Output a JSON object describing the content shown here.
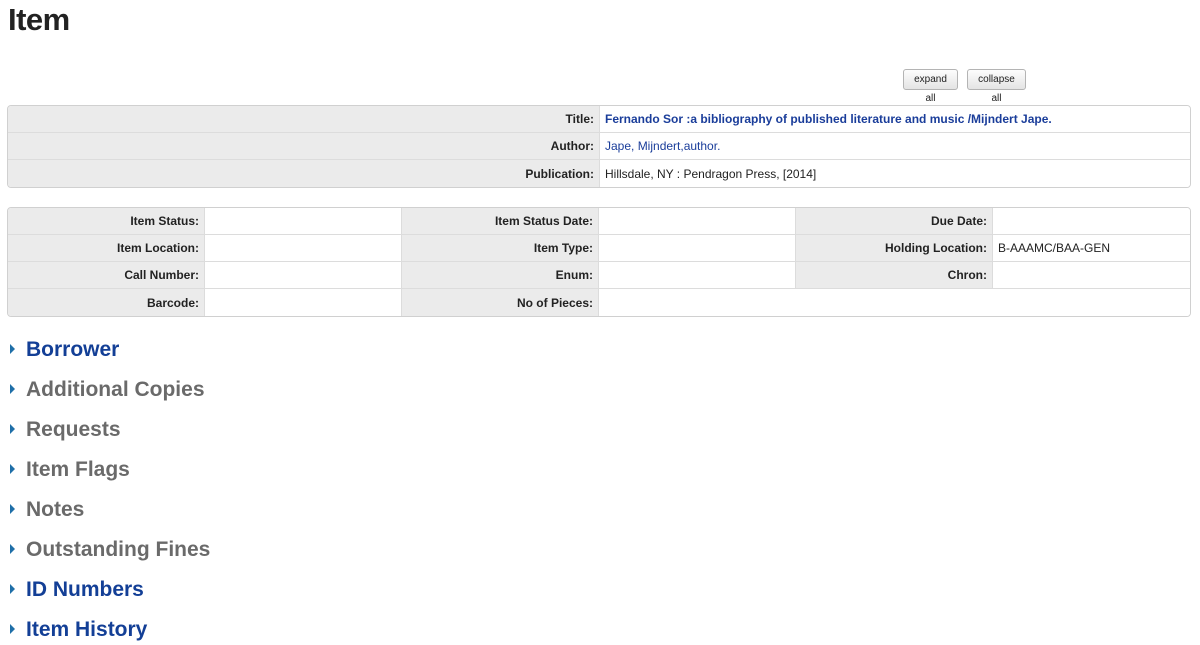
{
  "page": {
    "title": "Item"
  },
  "toolbar": {
    "expand_label": "expand all",
    "collapse_label": "collapse all"
  },
  "bib": {
    "title_label": "Title:",
    "title_value": "Fernando Sor :a bibliography of published literature and music /Mijndert Jape.",
    "author_label": "Author:",
    "author_value": "Jape, Mijndert,author.",
    "publication_label": "Publication:",
    "publication_value": "Hillsdale, NY : Pendragon Press, [2014]"
  },
  "item": {
    "item_status_label": "Item Status:",
    "item_status_value": "",
    "item_status_date_label": "Item Status Date:",
    "item_status_date_value": "",
    "due_date_label": "Due Date:",
    "due_date_value": "",
    "item_location_label": "Item Location:",
    "item_location_value": "",
    "item_type_label": "Item Type:",
    "item_type_value": "",
    "holding_location_label": "Holding Location:",
    "holding_location_value": "B-AAAMC/BAA-GEN",
    "call_number_label": "Call Number:",
    "call_number_value": "",
    "enum_label": "Enum:",
    "enum_value": "",
    "chron_label": "Chron:",
    "chron_value": "",
    "barcode_label": "Barcode:",
    "barcode_value": "",
    "pieces_label": "No of Pieces:",
    "pieces_value": ""
  },
  "sections": [
    {
      "label": "Borrower",
      "state": "active"
    },
    {
      "label": "Additional Copies",
      "state": "inactive"
    },
    {
      "label": "Requests",
      "state": "inactive"
    },
    {
      "label": "Item Flags",
      "state": "inactive"
    },
    {
      "label": "Notes",
      "state": "inactive"
    },
    {
      "label": "Outstanding Fines",
      "state": "inactive"
    },
    {
      "label": "ID Numbers",
      "state": "active"
    },
    {
      "label": "Item History",
      "state": "active"
    }
  ],
  "colors": {
    "link": "#1a3d9a",
    "section_active": "#133f96",
    "section_inactive": "#6a6a6a",
    "label_bg": "#ebebeb",
    "triangle": "#1f6fa8"
  },
  "icons": {
    "section_toggle": "caret-right-icon"
  }
}
